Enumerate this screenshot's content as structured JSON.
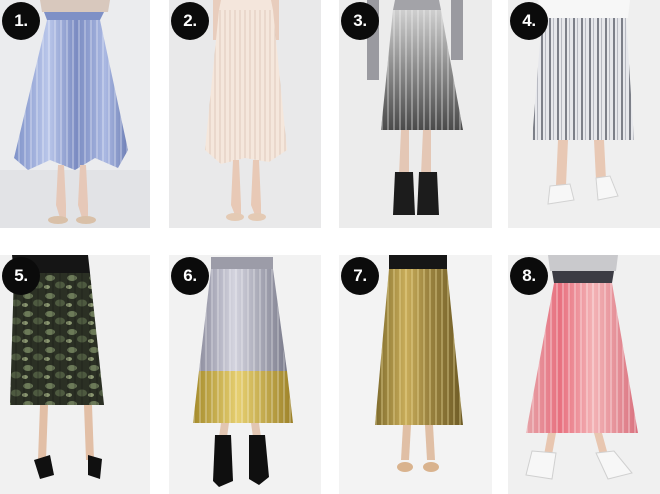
{
  "items": [
    {
      "number": "1.",
      "skirt": "blue metallic pleated midi skirt",
      "color": "#8f9fd0",
      "background": "#ebecee"
    },
    {
      "number": "2.",
      "skirt": "blush pleated midi skirt",
      "color": "#f3e4d8",
      "background": "#e9e9ea"
    },
    {
      "number": "3.",
      "skirt": "silver metallic pleated midi skirt",
      "color": "#8a8a8a",
      "background": "#ececec"
    },
    {
      "number": "4.",
      "skirt": "white striped pleated midi skirt",
      "color": "#dcdde2",
      "background": "#efefef"
    },
    {
      "number": "5.",
      "skirt": "camo print pleated midi skirt",
      "color": "#3f4a34",
      "background": "#f1f1f1"
    },
    {
      "number": "6.",
      "skirt": "silver and gold colour block pleated midi skirt",
      "color": "#a6a7b5",
      "background": "#f2f2f2"
    },
    {
      "number": "7.",
      "skirt": "gold metallic pleated midi skirt",
      "color": "#a28a3c",
      "background": "#f3f3f3"
    },
    {
      "number": "8.",
      "skirt": "pink metallic pleated midi skirt",
      "color": "#e48a98",
      "background": "#f0f0f0"
    }
  ]
}
